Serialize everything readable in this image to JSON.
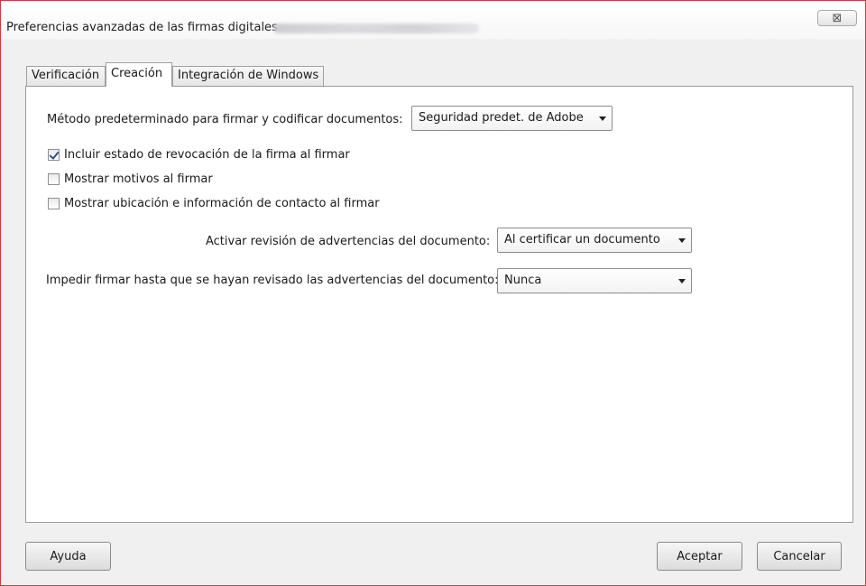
{
  "window": {
    "title": "Preferencias avanzadas de las firmas digitales",
    "close_glyph": "⊠"
  },
  "tabs": [
    {
      "label": "Verificación",
      "active": false
    },
    {
      "label": "Creación",
      "active": true
    },
    {
      "label": "Integración de Windows",
      "active": false
    }
  ],
  "creation": {
    "signing_method": {
      "label": "Método predeterminado para firmar y codificar documentos:",
      "value": "Seguridad predet. de Adobe"
    },
    "checkboxes": [
      {
        "label": "Incluir estado de revocación de la firma al firmar",
        "checked": true
      },
      {
        "label": "Mostrar motivos al firmar",
        "checked": false
      },
      {
        "label": "Mostrar ubicación e información de contacto al firmar",
        "checked": false
      }
    ],
    "warnings_review": {
      "label": "Activar revisión de advertencias del documento:",
      "value": "Al certificar un documento"
    },
    "prevent_signing": {
      "label": "Impedir firmar hasta que se hayan revisado las advertencias del documento:",
      "value": "Nunca"
    }
  },
  "footer": {
    "help_label": "Ayuda",
    "ok_label": "Aceptar",
    "cancel_label": "Cancelar"
  }
}
